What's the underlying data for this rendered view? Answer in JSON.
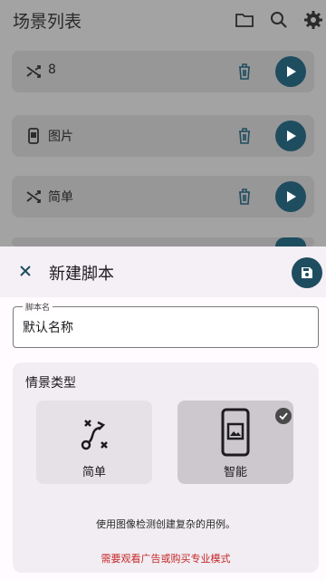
{
  "background": {
    "title": "场景列表",
    "toolbar_icons": [
      "folder-icon",
      "search-icon",
      "gear-icon"
    ],
    "scenarios": [
      {
        "label": "8",
        "icon": "shuffle-icon"
      },
      {
        "label": "图片",
        "icon": "phone-image-icon"
      },
      {
        "label": "简单",
        "icon": "shuffle-icon"
      }
    ]
  },
  "sheet": {
    "title": "新建脚本",
    "name_field": {
      "label": "脚本名",
      "value": "默认名称"
    },
    "type_card": {
      "title": "情景类型",
      "options": [
        {
          "label": "简单",
          "icon": "flow-path-icon",
          "selected": false
        },
        {
          "label": "智能",
          "icon": "phone-image-icon",
          "selected": true
        }
      ],
      "description": "使用图像检测创建复杂的用例。",
      "warning": "需要观看广告或购买专业模式"
    }
  },
  "colors": {
    "accent": "#1f4d60",
    "warning": "#c62828",
    "sheet_bg": "#fffbfe",
    "scrim": "#a3a3a3"
  }
}
